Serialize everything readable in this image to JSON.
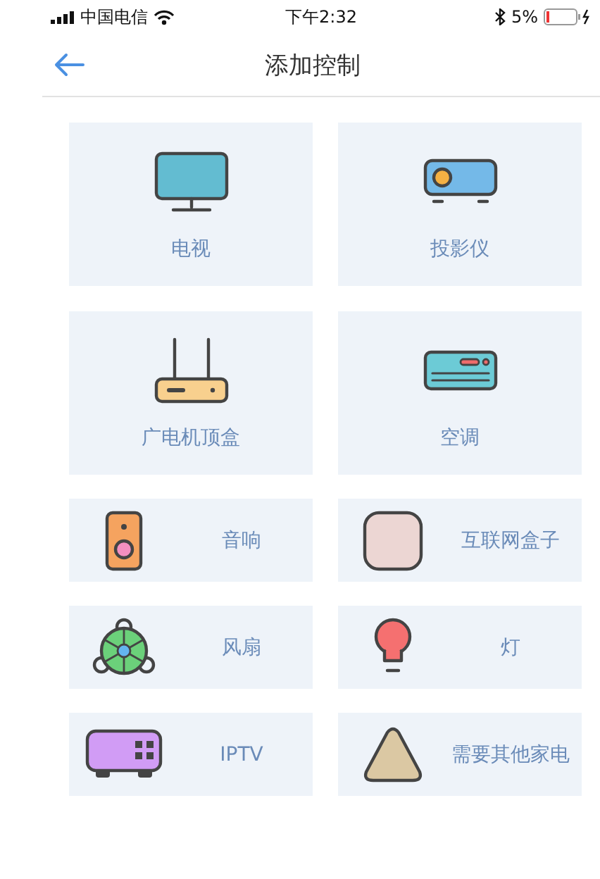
{
  "status_bar": {
    "carrier": "中国电信",
    "time": "下午2:32",
    "battery": "5%"
  },
  "header": {
    "title": "添加控制"
  },
  "large_devices": [
    {
      "kind": "tv",
      "label": "电视"
    },
    {
      "kind": "projector",
      "label": "投影仪"
    },
    {
      "kind": "settop",
      "label": "广电机顶盒"
    },
    {
      "kind": "aircon",
      "label": "空调"
    }
  ],
  "small_devices": [
    {
      "kind": "speaker",
      "label": "音响"
    },
    {
      "kind": "netbox",
      "label": "互联网盒子"
    },
    {
      "kind": "fan",
      "label": "风扇"
    },
    {
      "kind": "lamp",
      "label": "灯"
    },
    {
      "kind": "iptv",
      "label": "IPTV"
    },
    {
      "kind": "other",
      "label": "需要其他家电"
    }
  ]
}
